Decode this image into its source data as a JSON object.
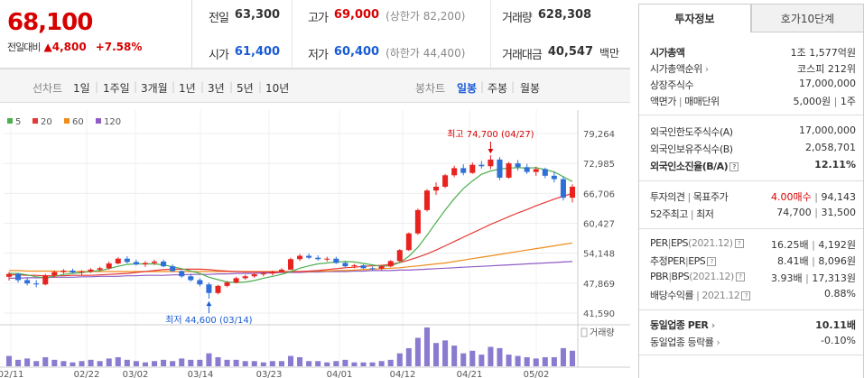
{
  "price": {
    "current": "68,100",
    "change_label": "전일대비",
    "change_arrow": "▲",
    "change": "4,800",
    "change_pct": "+7.58%"
  },
  "stats": {
    "prev_close": {
      "label": "전일",
      "value": "63,300"
    },
    "open": {
      "label": "시가",
      "value": "61,400"
    },
    "high": {
      "label": "고가",
      "value": "69,000",
      "sub": "(상한가 82,200)"
    },
    "low": {
      "label": "저가",
      "value": "60,400",
      "sub": "(하한가 44,400)"
    },
    "volume": {
      "label": "거래량",
      "value": "628,308"
    },
    "amount": {
      "label": "거래대금",
      "value": "40,547",
      "unit": "백만"
    }
  },
  "toolbar": {
    "line_chart": "선차트",
    "periods": [
      "1일",
      "1주일",
      "3개월",
      "1년",
      "3년",
      "5년",
      "10년"
    ],
    "candle": "봉차트",
    "candle_periods": [
      "일봉",
      "주봉",
      "월봉"
    ],
    "selected_candle": "일봉"
  },
  "chart_data": {
    "type": "candlestick",
    "legend": [
      {
        "name": "5",
        "color": "#4caf50"
      },
      {
        "name": "20",
        "color": "#e53935"
      },
      {
        "name": "60",
        "color": "#ef8c1a"
      },
      {
        "name": "120",
        "color": "#8e5cc5"
      }
    ],
    "y_ticks": [
      "79,264",
      "72,985",
      "66,706",
      "60,427",
      "54,148",
      "47,869",
      "41,590"
    ],
    "y_range": [
      41590,
      79264
    ],
    "x_labels": [
      "02/11",
      "02/22",
      "03/02",
      "03/14",
      "03/23",
      "04/01",
      "04/12",
      "04/21",
      "05/02"
    ],
    "high_label": "최고 74,700 (04/27)",
    "low_label": "최저 44,600 (03/14)",
    "volume_label": "거래량",
    "candles": [
      [
        49200,
        50200,
        48400,
        49800
      ],
      [
        49800,
        50000,
        48000,
        48500
      ],
      [
        48500,
        49000,
        47400,
        47800
      ],
      [
        47800,
        48500,
        47000,
        47600
      ],
      [
        47600,
        49800,
        47400,
        49500
      ],
      [
        49500,
        50500,
        49000,
        50200
      ],
      [
        50200,
        50800,
        49800,
        50500
      ],
      [
        50500,
        50900,
        49900,
        50100
      ],
      [
        50100,
        50600,
        49600,
        50300
      ],
      [
        50300,
        51000,
        50000,
        50700
      ],
      [
        50700,
        51300,
        50300,
        51000
      ],
      [
        51000,
        52400,
        50700,
        52000
      ],
      [
        52000,
        53300,
        51800,
        53000
      ],
      [
        53000,
        53500,
        52000,
        52300
      ],
      [
        52300,
        52800,
        51600,
        51800
      ],
      [
        51800,
        52500,
        51300,
        52100
      ],
      [
        52100,
        52800,
        51700,
        52400
      ],
      [
        52400,
        52800,
        51200,
        51400
      ],
      [
        51400,
        51800,
        50200,
        50400
      ],
      [
        50400,
        50600,
        49000,
        49300
      ],
      [
        49300,
        49800,
        48200,
        48500
      ],
      [
        48500,
        48900,
        47200,
        47600
      ],
      [
        47600,
        48000,
        44600,
        45800
      ],
      [
        45800,
        47500,
        45500,
        47300
      ],
      [
        47300,
        48300,
        47000,
        48000
      ],
      [
        48000,
        49200,
        47800,
        48900
      ],
      [
        48900,
        49600,
        48600,
        49300
      ],
      [
        49300,
        50000,
        49000,
        49700
      ],
      [
        49700,
        50200,
        49300,
        49900
      ],
      [
        49900,
        50500,
        49500,
        50300
      ],
      [
        50300,
        51000,
        50000,
        50700
      ],
      [
        50700,
        53200,
        50600,
        52900
      ],
      [
        52900,
        54000,
        52500,
        53600
      ],
      [
        53600,
        54100,
        52900,
        53200
      ],
      [
        53200,
        53700,
        52600,
        52900
      ],
      [
        52900,
        53400,
        52400,
        53000
      ],
      [
        53000,
        53400,
        51900,
        52100
      ],
      [
        52100,
        52500,
        51200,
        51400
      ],
      [
        51400,
        51900,
        51000,
        51600
      ],
      [
        51600,
        51800,
        50800,
        51000
      ],
      [
        51000,
        51300,
        50500,
        50900
      ],
      [
        50900,
        51600,
        50600,
        51400
      ],
      [
        51400,
        52700,
        51200,
        52500
      ],
      [
        52500,
        55000,
        52300,
        54800
      ],
      [
        54800,
        58500,
        54600,
        58300
      ],
      [
        58300,
        63500,
        58000,
        63200
      ],
      [
        63200,
        67600,
        62900,
        67300
      ],
      [
        67300,
        69000,
        66400,
        68100
      ],
      [
        68100,
        70800,
        67800,
        70500
      ],
      [
        70500,
        72500,
        70100,
        72000
      ],
      [
        72000,
        72800,
        70500,
        71000
      ],
      [
        71000,
        73200,
        70800,
        72700
      ],
      [
        72700,
        73500,
        71900,
        72400
      ],
      [
        72400,
        74700,
        71800,
        73800
      ],
      [
        73800,
        74300,
        69500,
        70000
      ],
      [
        70000,
        73300,
        69800,
        73000
      ],
      [
        73000,
        73700,
        71500,
        72200
      ],
      [
        72200,
        72900,
        70800,
        71200
      ],
      [
        71200,
        72300,
        70400,
        71800
      ],
      [
        71800,
        72100,
        69900,
        70400
      ],
      [
        70400,
        71300,
        69000,
        69700
      ],
      [
        69700,
        70300,
        65200,
        65800
      ],
      [
        65800,
        68600,
        64800,
        68100
      ]
    ],
    "ma5": [
      49900,
      49900,
      49600,
      49200,
      49000,
      49300,
      49700,
      49900,
      50100,
      50300,
      50500,
      50900,
      51400,
      51800,
      51900,
      51900,
      51900,
      51700,
      51300,
      50900,
      50400,
      49900,
      49100,
      48600,
      48100,
      48000,
      48100,
      48400,
      48900,
      49300,
      49700,
      50300,
      51000,
      51500,
      51900,
      52100,
      52300,
      52400,
      52300,
      52000,
      51700,
      51400,
      51500,
      52200,
      53500,
      55400,
      57900,
      60600,
      63200,
      65600,
      67700,
      69300,
      70700,
      71400,
      71800,
      72000,
      72100,
      72000,
      72100,
      71700,
      71200,
      70200,
      69200
    ],
    "ma20": [
      49600,
      49600,
      49500,
      49500,
      49400,
      49400,
      49400,
      49500,
      49500,
      49500,
      49600,
      49700,
      49800,
      49900,
      50100,
      50300,
      50500,
      50700,
      50800,
      50800,
      50800,
      50800,
      50700,
      50500,
      50400,
      50300,
      50200,
      50200,
      50200,
      50200,
      50200,
      50300,
      50300,
      50400,
      50500,
      50700,
      50900,
      51100,
      51200,
      51400,
      51500,
      51600,
      51800,
      52200,
      52700,
      53300,
      54000,
      54800,
      55700,
      56600,
      57500,
      58400,
      59300,
      60200,
      61000,
      61800,
      62600,
      63300,
      64100,
      64800,
      65500,
      66100,
      66700
    ],
    "ma60": [
      50500,
      50500,
      50400,
      50400,
      50400,
      50400,
      50300,
      50300,
      50300,
      50300,
      50300,
      50300,
      50300,
      50300,
      50300,
      50300,
      50300,
      50300,
      50300,
      50300,
      50300,
      50300,
      50300,
      50300,
      50300,
      50300,
      50300,
      50300,
      50300,
      50300,
      50300,
      50300,
      50300,
      50300,
      50400,
      50400,
      50500,
      50500,
      50600,
      50700,
      50800,
      50900,
      51000,
      51100,
      51300,
      51500,
      51700,
      51900,
      52100,
      52400,
      52700,
      53000,
      53300,
      53600,
      53900,
      54200,
      54500,
      54800,
      55100,
      55400,
      55700,
      56000,
      56300
    ],
    "ma120": [
      48900,
      48900,
      49000,
      49000,
      49000,
      49100,
      49100,
      49100,
      49200,
      49200,
      49300,
      49300,
      49300,
      49400,
      49400,
      49500,
      49500,
      49500,
      49600,
      49600,
      49700,
      49700,
      49700,
      49800,
      49800,
      49900,
      49900,
      49900,
      50000,
      50000,
      50100,
      50100,
      50100,
      50200,
      50200,
      50300,
      50300,
      50300,
      50400,
      50400,
      50500,
      50500,
      50500,
      50600,
      50600,
      50700,
      50800,
      50900,
      51000,
      51100,
      51200,
      51300,
      51400,
      51500,
      51600,
      51700,
      51800,
      51900,
      52000,
      52100,
      52200,
      52300,
      52400
    ],
    "volumes": [
      8,
      5,
      6,
      4,
      7,
      5,
      4,
      3,
      4,
      5,
      4,
      6,
      7,
      5,
      4,
      3,
      4,
      5,
      4,
      6,
      5,
      5,
      10,
      7,
      5,
      5,
      4,
      4,
      3,
      4,
      4,
      8,
      7,
      4,
      4,
      3,
      4,
      5,
      3,
      3,
      3,
      4,
      5,
      10,
      14,
      22,
      30,
      18,
      20,
      16,
      10,
      12,
      9,
      15,
      14,
      9,
      8,
      7,
      6,
      7,
      7,
      14,
      12
    ]
  },
  "right": {
    "tabs": [
      "투자정보",
      "호가10단계"
    ],
    "market_cap": {
      "label": "시가총액",
      "value": "1조 1,577억원"
    },
    "market_cap_rank": {
      "label": "시가총액순위",
      "value": "코스피 212위"
    },
    "shares": {
      "label": "상장주식수",
      "value": "17,000,000"
    },
    "par": {
      "label": "액면가",
      "sep": "|",
      "label2": "매매단위",
      "value": "5,000원",
      "value2": "1주"
    },
    "foreign_limit": {
      "label": "외국인한도주식수(A)",
      "value": "17,000,000"
    },
    "foreign_hold": {
      "label": "외국인보유주식수(B)",
      "value": "2,058,701"
    },
    "foreign_ratio": {
      "label": "외국인소진율(B/A)",
      "value": "12.11%"
    },
    "opinion": {
      "label": "투자의견",
      "sep": "|",
      "label2": "목표주가",
      "value": "4.00매수",
      "value2": "94,143"
    },
    "week52": {
      "label": "52주최고",
      "sep": "|",
      "label2": "최저",
      "value": "74,700",
      "value2": "31,500"
    },
    "per": {
      "label": "PER",
      "label2": "EPS",
      "date": "(2021.12)",
      "value": "16.25배",
      "value2": "4,192원"
    },
    "est_per": {
      "label": "추정PER",
      "label2": "EPS",
      "value": "8.41배",
      "value2": "8,096원"
    },
    "pbr": {
      "label": "PBR",
      "label2": "BPS",
      "date": "(2021.12)",
      "value": "3.93배",
      "value2": "17,313원"
    },
    "div": {
      "label": "배당수익률",
      "date": "2021.12",
      "value": "0.88%"
    },
    "sector_per": {
      "label": "동일업종 PER",
      "value": "10.11배"
    },
    "sector_rate": {
      "label": "동일업종 등락률",
      "value": "-0.10%"
    }
  }
}
